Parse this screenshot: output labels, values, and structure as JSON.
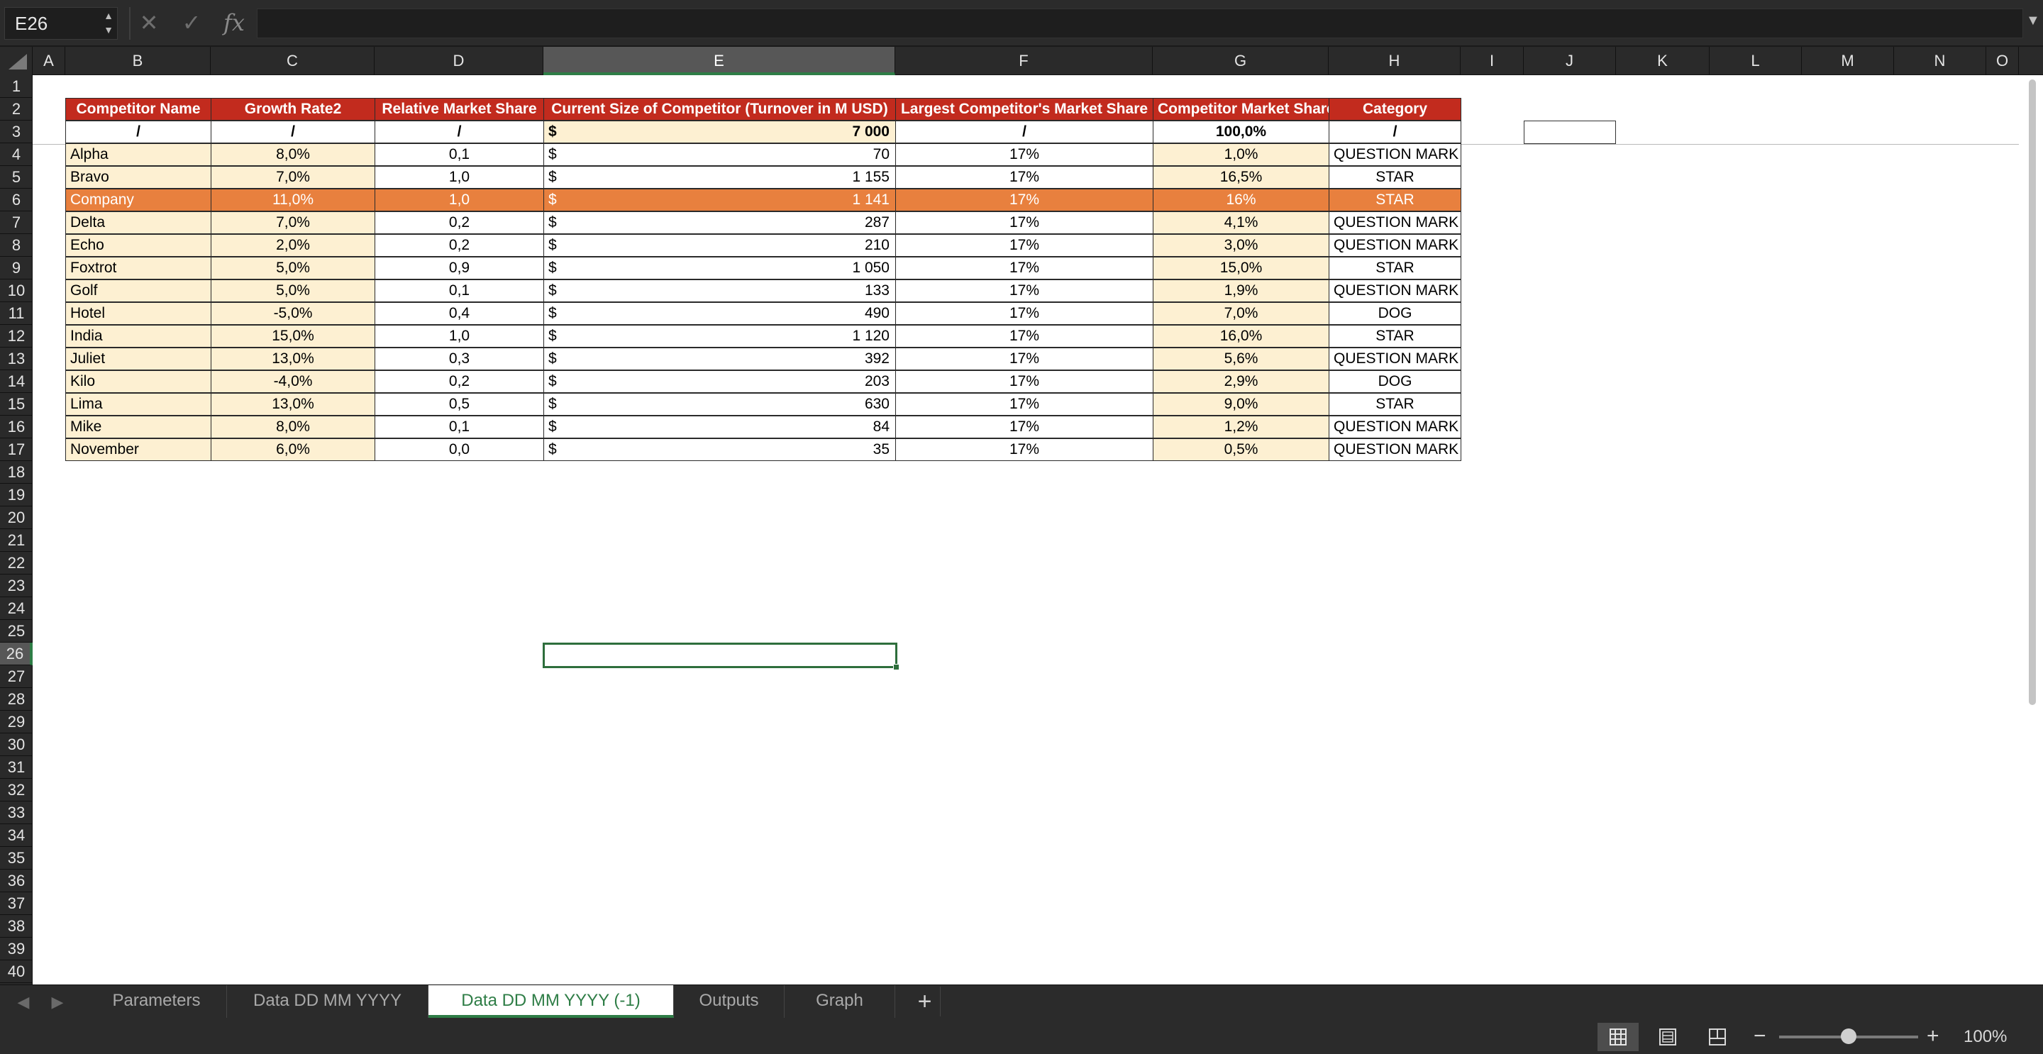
{
  "name_box": "E26",
  "fx_label": "fx",
  "columns": [
    "A",
    "B",
    "C",
    "D",
    "E",
    "F",
    "G",
    "H",
    "I",
    "J",
    "K",
    "L",
    "M",
    "N",
    "O"
  ],
  "selected_column": "E",
  "selected_row": "26",
  "row_count": 40,
  "table": {
    "headers": [
      "Competitor Name",
      "Growth Rate2",
      "Relative Market Share",
      "Current Size of Competitor (Turnover in M USD)",
      "Largest Competitor's Market Share",
      "Competitor Market Share",
      "Category"
    ],
    "totals": {
      "name": "/",
      "growth": "/",
      "rms": "/",
      "currency": "$",
      "size": "7 000",
      "largest": "/",
      "share": "100,0%",
      "category": "/"
    },
    "rows": [
      {
        "name": "Alpha",
        "growth": "8,0%",
        "rms": "0,1",
        "currency": "$",
        "size": "70",
        "largest": "17%",
        "share": "1,0%",
        "category": "QUESTION MARK"
      },
      {
        "name": "Bravo",
        "growth": "7,0%",
        "rms": "1,0",
        "currency": "$",
        "size": "1 155",
        "largest": "17%",
        "share": "16,5%",
        "category": "STAR"
      },
      {
        "name": "Company",
        "growth": "11,0%",
        "rms": "1,0",
        "currency": "$",
        "size": "1 141",
        "largest": "17%",
        "share": "16%",
        "category": "STAR"
      },
      {
        "name": "Delta",
        "growth": "7,0%",
        "rms": "0,2",
        "currency": "$",
        "size": "287",
        "largest": "17%",
        "share": "4,1%",
        "category": "QUESTION MARK"
      },
      {
        "name": "Echo",
        "growth": "2,0%",
        "rms": "0,2",
        "currency": "$",
        "size": "210",
        "largest": "17%",
        "share": "3,0%",
        "category": "QUESTION MARK"
      },
      {
        "name": "Foxtrot",
        "growth": "5,0%",
        "rms": "0,9",
        "currency": "$",
        "size": "1 050",
        "largest": "17%",
        "share": "15,0%",
        "category": "STAR"
      },
      {
        "name": "Golf",
        "growth": "5,0%",
        "rms": "0,1",
        "currency": "$",
        "size": "133",
        "largest": "17%",
        "share": "1,9%",
        "category": "QUESTION MARK"
      },
      {
        "name": "Hotel",
        "growth": "-5,0%",
        "rms": "0,4",
        "currency": "$",
        "size": "490",
        "largest": "17%",
        "share": "7,0%",
        "category": "DOG"
      },
      {
        "name": "India",
        "growth": "15,0%",
        "rms": "1,0",
        "currency": "$",
        "size": "1 120",
        "largest": "17%",
        "share": "16,0%",
        "category": "STAR"
      },
      {
        "name": "Juliet",
        "growth": "13,0%",
        "rms": "0,3",
        "currency": "$",
        "size": "392",
        "largest": "17%",
        "share": "5,6%",
        "category": "QUESTION MARK"
      },
      {
        "name": "Kilo",
        "growth": "-4,0%",
        "rms": "0,2",
        "currency": "$",
        "size": "203",
        "largest": "17%",
        "share": "2,9%",
        "category": "DOG"
      },
      {
        "name": "Lima",
        "growth": "13,0%",
        "rms": "0,5",
        "currency": "$",
        "size": "630",
        "largest": "17%",
        "share": "9,0%",
        "category": "STAR"
      },
      {
        "name": "Mike",
        "growth": "8,0%",
        "rms": "0,1",
        "currency": "$",
        "size": "84",
        "largest": "17%",
        "share": "1,2%",
        "category": "QUESTION MARK"
      },
      {
        "name": "November",
        "growth": "6,0%",
        "rms": "0,0",
        "currency": "$",
        "size": "35",
        "largest": "17%",
        "share": "0,5%",
        "category": "QUESTION MARK"
      }
    ],
    "highlighted_row": "Company"
  },
  "sheet_tabs": [
    "Parameters",
    "Data DD MM YYYY",
    "Data DD MM YYYY (-1)",
    "Outputs",
    "Graph"
  ],
  "active_tab": "Data DD MM YYYY (-1)",
  "add_sheet_label": "+",
  "zoom": {
    "minus": "−",
    "plus": "+",
    "level": "100%",
    "fraction": 0.5
  },
  "colors": {
    "header_red": "#c22b1e",
    "cream": "#fdf0d2",
    "highlight_orange": "#e8803e",
    "selection_green": "#2e7d46"
  },
  "icons": [
    "cancel-icon",
    "confirm-icon",
    "fx-icon",
    "normal-view-icon",
    "page-layout-icon",
    "page-break-icon"
  ]
}
